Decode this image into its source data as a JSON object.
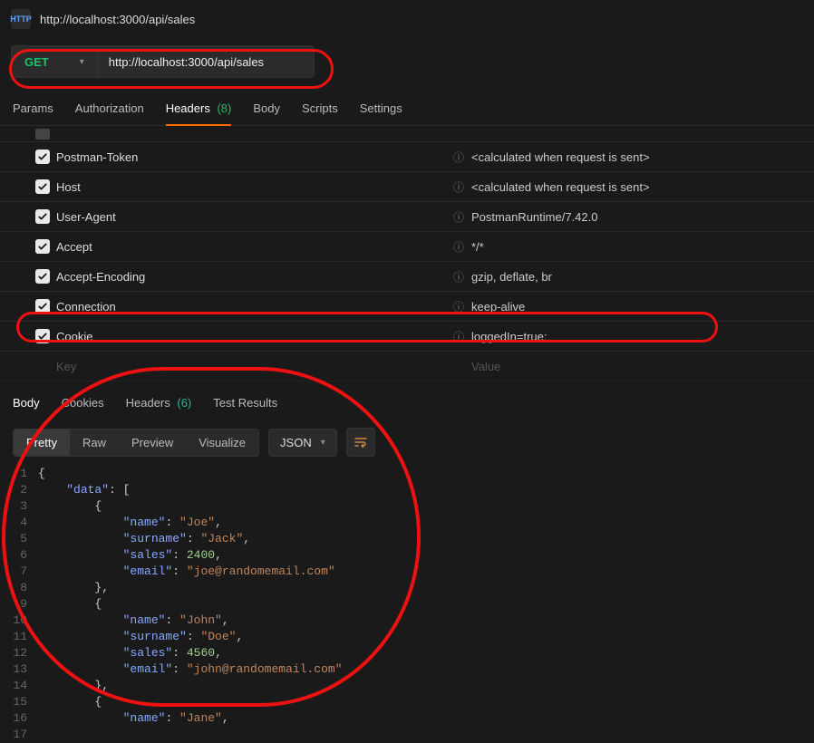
{
  "titlebar": {
    "http_badge": "HTTP",
    "title": "http://localhost:3000/api/sales"
  },
  "request": {
    "method": "GET",
    "url": "http://localhost:3000/api/sales"
  },
  "tabs": {
    "params": "Params",
    "authorization": "Authorization",
    "headers": "Headers",
    "headers_count": "(8)",
    "body": "Body",
    "scripts": "Scripts",
    "settings": "Settings"
  },
  "headers_table": {
    "key_label": "Key",
    "value_label": "Value",
    "calc_text": "<calculated when request is sent>",
    "rows": [
      {
        "key": "Postman-Token",
        "value": "<calculated when request is sent>"
      },
      {
        "key": "Host",
        "value": "<calculated when request is sent>"
      },
      {
        "key": "User-Agent",
        "value": "PostmanRuntime/7.42.0"
      },
      {
        "key": "Accept",
        "value": "*/*"
      },
      {
        "key": "Accept-Encoding",
        "value": "gzip, deflate, br"
      },
      {
        "key": "Connection",
        "value": "keep-alive"
      },
      {
        "key": "Cookie",
        "value": "loggedIn=true;"
      }
    ]
  },
  "response_tabs": {
    "body": "Body",
    "cookies": "Cookies",
    "headers": "Headers",
    "headers_count": "(6)",
    "test_results": "Test Results"
  },
  "view_modes": {
    "pretty": "Pretty",
    "raw": "Raw",
    "preview": "Preview",
    "visualize": "Visualize",
    "lang": "JSON"
  },
  "response_body": {
    "data": [
      {
        "name": "Joe",
        "surname": "Jack",
        "sales": 2400,
        "email": "joe@randomemail.com"
      },
      {
        "name": "John",
        "surname": "Doe",
        "sales": 4560,
        "email": "john@randomemail.com"
      },
      {
        "name": "Jane"
      }
    ]
  },
  "code_lines": [
    {
      "n": 1,
      "indent": 0,
      "tokens": [
        [
          "p",
          "{"
        ]
      ]
    },
    {
      "n": 2,
      "indent": 1,
      "tokens": [
        [
          "k",
          "\"data\""
        ],
        [
          "p",
          ": ["
        ]
      ]
    },
    {
      "n": 3,
      "indent": 2,
      "tokens": [
        [
          "p",
          "{"
        ]
      ]
    },
    {
      "n": 4,
      "indent": 3,
      "tokens": [
        [
          "k",
          "\"name\""
        ],
        [
          "p",
          ": "
        ],
        [
          "s",
          "\"Joe\""
        ],
        [
          "p",
          ","
        ]
      ]
    },
    {
      "n": 5,
      "indent": 3,
      "tokens": [
        [
          "k",
          "\"surname\""
        ],
        [
          "p",
          ": "
        ],
        [
          "s",
          "\"Jack\""
        ],
        [
          "p",
          ","
        ]
      ]
    },
    {
      "n": 6,
      "indent": 3,
      "tokens": [
        [
          "k",
          "\"sales\""
        ],
        [
          "p",
          ": "
        ],
        [
          "n",
          "2400"
        ],
        [
          "p",
          ","
        ]
      ]
    },
    {
      "n": 7,
      "indent": 3,
      "tokens": [
        [
          "k",
          "\"email\""
        ],
        [
          "p",
          ": "
        ],
        [
          "s",
          "\"joe@randomemail.com\""
        ]
      ]
    },
    {
      "n": 8,
      "indent": 2,
      "tokens": [
        [
          "p",
          "},"
        ]
      ]
    },
    {
      "n": 9,
      "indent": 2,
      "tokens": [
        [
          "p",
          "{"
        ]
      ]
    },
    {
      "n": 10,
      "indent": 3,
      "tokens": [
        [
          "k",
          "\"name\""
        ],
        [
          "p",
          ": "
        ],
        [
          "s",
          "\"John\""
        ],
        [
          "p",
          ","
        ]
      ]
    },
    {
      "n": 11,
      "indent": 3,
      "tokens": [
        [
          "k",
          "\"surname\""
        ],
        [
          "p",
          ": "
        ],
        [
          "s",
          "\"Doe\""
        ],
        [
          "p",
          ","
        ]
      ]
    },
    {
      "n": 12,
      "indent": 3,
      "tokens": [
        [
          "k",
          "\"sales\""
        ],
        [
          "p",
          ": "
        ],
        [
          "n",
          "4560"
        ],
        [
          "p",
          ","
        ]
      ]
    },
    {
      "n": 13,
      "indent": 3,
      "tokens": [
        [
          "k",
          "\"email\""
        ],
        [
          "p",
          ": "
        ],
        [
          "s",
          "\"john@randomemail.com\""
        ]
      ]
    },
    {
      "n": 14,
      "indent": 2,
      "tokens": [
        [
          "p",
          "},"
        ]
      ]
    },
    {
      "n": 15,
      "indent": 2,
      "tokens": [
        [
          "p",
          "{"
        ]
      ]
    },
    {
      "n": 16,
      "indent": 3,
      "tokens": [
        [
          "k",
          "\"name\""
        ],
        [
          "p",
          ": "
        ],
        [
          "s",
          "\"Jane\""
        ],
        [
          "p",
          ","
        ]
      ]
    },
    {
      "n": 17,
      "indent": 3,
      "tokens": []
    }
  ]
}
